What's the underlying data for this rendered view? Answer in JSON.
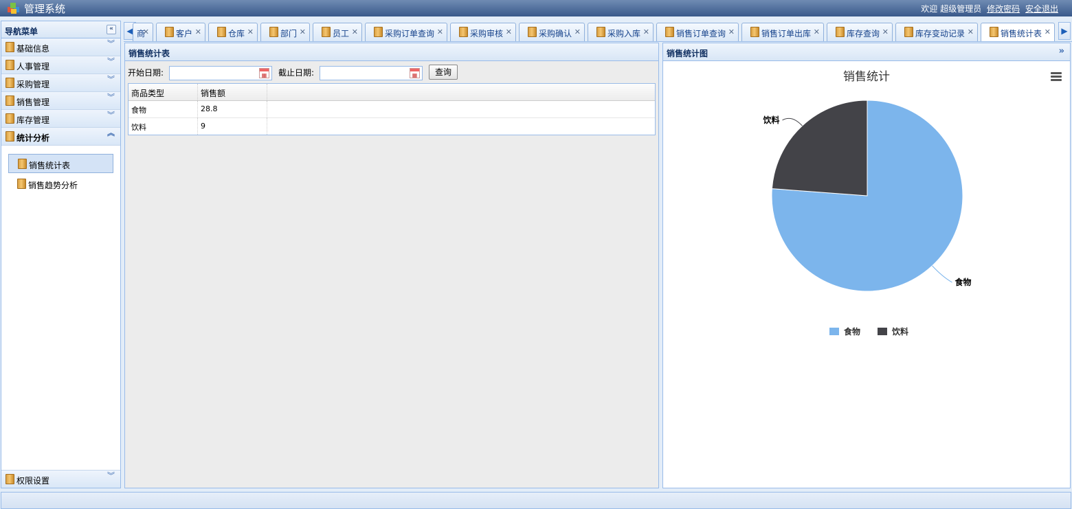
{
  "app": {
    "title": "管理系统"
  },
  "header": {
    "welcome": "欢迎",
    "username": "超级管理员",
    "change_password": "修改密码",
    "logout": "安全退出"
  },
  "sidebar": {
    "title": "导航菜单",
    "sections": [
      {
        "label": "基础信息"
      },
      {
        "label": "人事管理"
      },
      {
        "label": "采购管理"
      },
      {
        "label": "销售管理"
      },
      {
        "label": "库存管理"
      },
      {
        "label": "统计分析"
      }
    ],
    "active_items": [
      {
        "label": "销售统计表"
      },
      {
        "label": "销售趋势分析"
      }
    ],
    "bottom_section": {
      "label": "权限设置"
    }
  },
  "tabs": [
    {
      "label": "商"
    },
    {
      "label": "客户"
    },
    {
      "label": "仓库"
    },
    {
      "label": "部门"
    },
    {
      "label": "员工"
    },
    {
      "label": "采购订单查询"
    },
    {
      "label": "采购审核"
    },
    {
      "label": "采购确认"
    },
    {
      "label": "采购入库"
    },
    {
      "label": "销售订单查询"
    },
    {
      "label": "销售订单出库"
    },
    {
      "label": "库存查询"
    },
    {
      "label": "库存变动记录"
    },
    {
      "label": "销售统计表"
    }
  ],
  "left_panel": {
    "title": "销售统计表",
    "start_date_label": "开始日期:",
    "start_date_value": "",
    "end_date_label": "截止日期:",
    "end_date_value": "",
    "query_button": "查询",
    "table": {
      "columns": [
        "商品类型",
        "销售额"
      ],
      "rows": [
        [
          "食物",
          "28.8"
        ],
        [
          "饮料",
          "9"
        ]
      ]
    }
  },
  "right_panel": {
    "title": "销售统计图"
  },
  "chart_data": {
    "type": "pie",
    "title": "销售统计",
    "categories": [
      "食物",
      "饮料"
    ],
    "values": [
      28.8,
      9
    ],
    "colors": [
      "#7cb5ec",
      "#434348"
    ],
    "legend_position": "bottom"
  }
}
